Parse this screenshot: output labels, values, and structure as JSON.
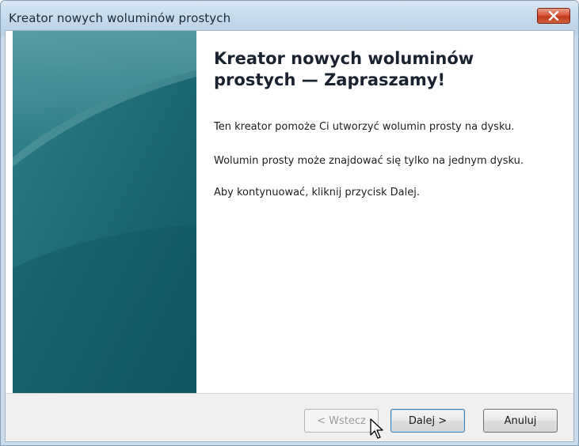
{
  "window": {
    "title": "Kreator nowych woluminów prostych"
  },
  "wizard": {
    "heading": "Kreator nowych woluminów prostych — Zapraszamy!",
    "paragraphs": [
      "Ten kreator pomoże Ci utworzyć wolumin prosty na dysku.",
      "Wolumin prosty może znajdować się tylko na jednym dysku.",
      "Aby kontynuować, kliknij przycisk Dalej."
    ]
  },
  "buttons": {
    "back_label": "< Wstecz",
    "next_label": "Dalej >",
    "cancel_label": "Anuluj"
  },
  "icons": {
    "close": "close-icon",
    "cursor": "mouse-pointer-icon"
  },
  "colors": {
    "banner": "#1f6b73",
    "close_button": "#c9462a",
    "default_button_border": "#3c7fb1"
  }
}
